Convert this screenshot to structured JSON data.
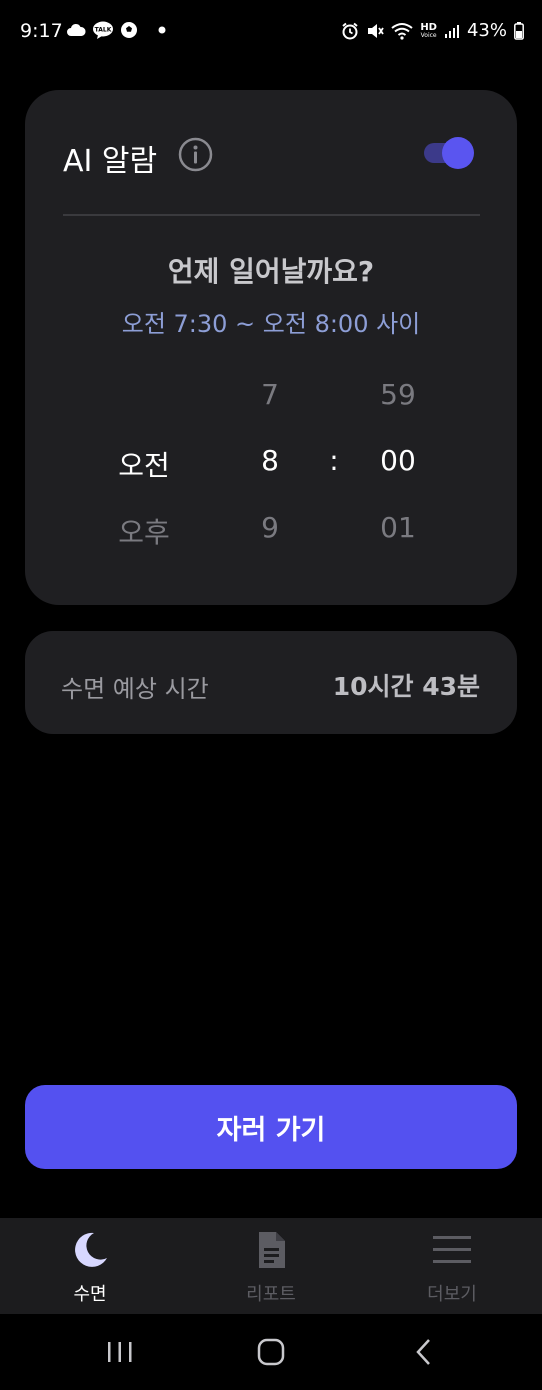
{
  "status_bar": {
    "time": "9:17",
    "left_icons": [
      "cloud-icon",
      "kakaotalk-icon",
      "soccer-ball-icon",
      "dot-icon"
    ],
    "kakaotalk_badge": "TALK",
    "right_icons": [
      "alarm-icon",
      "mute-icon",
      "wifi-calling-icon",
      "hd-voice-icon",
      "signal-icon",
      "battery-icon"
    ],
    "hd_label": "HD",
    "voice_label": "Voice",
    "battery_percent": "43%"
  },
  "alarm_card": {
    "title": "AI 알람",
    "toggle_on": true,
    "question": "언제 일어날까요?",
    "window_text": "오전 7:30 ~ 오전 8:00 사이",
    "picker": {
      "ampm_selected": "오전",
      "ampm_next": "오후",
      "hour_prev": "7",
      "hour_selected": "8",
      "hour_next": "9",
      "separator": ":",
      "minute_prev": "59",
      "minute_selected": "00",
      "minute_next": "01"
    }
  },
  "sleep_card": {
    "label": "수면 예상 시간",
    "value": "10시간 43분"
  },
  "primary_button": {
    "label": "자러 가기"
  },
  "tabs": [
    {
      "label": "수면",
      "icon": "moon-icon",
      "active": true
    },
    {
      "label": "리포트",
      "icon": "document-icon",
      "active": false
    },
    {
      "label": "더보기",
      "icon": "menu-icon",
      "active": false
    }
  ],
  "colors": {
    "accent": "#5451f0",
    "card_bg": "#1f1f22",
    "window_text": "#8d9ed6",
    "tab_active": "#ffffff",
    "tab_inactive": "#5c5c62"
  }
}
